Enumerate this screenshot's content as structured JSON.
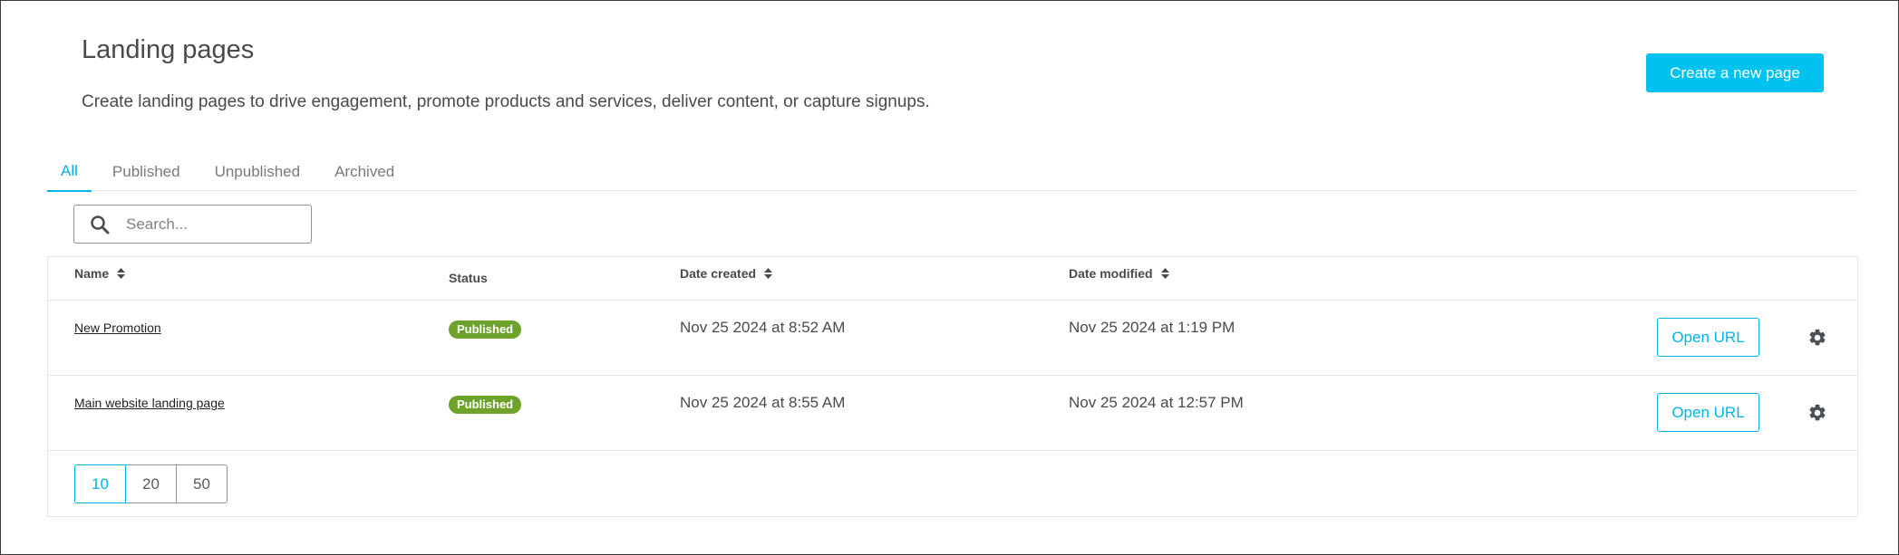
{
  "header": {
    "title": "Landing pages",
    "description": "Create landing pages to drive engagement, promote products and services, deliver content, or capture signups.",
    "create_button": "Create a new page"
  },
  "tabs": [
    {
      "label": "All",
      "active": true
    },
    {
      "label": "Published",
      "active": false
    },
    {
      "label": "Unpublished",
      "active": false
    },
    {
      "label": "Archived",
      "active": false
    }
  ],
  "search": {
    "placeholder": "Search...",
    "value": ""
  },
  "table": {
    "columns": {
      "name": "Name",
      "status": "Status",
      "date_created": "Date created",
      "date_modified": "Date modified"
    },
    "rows": [
      {
        "name": "New Promotion",
        "status": "Published",
        "date_created": "Nov 25 2024 at 8:52 AM",
        "date_modified": "Nov 25 2024 at 1:19 PM",
        "action": "Open URL"
      },
      {
        "name": "Main website landing page",
        "status": "Published",
        "date_created": "Nov 25 2024 at 8:55 AM",
        "date_modified": "Nov 25 2024 at 12:57 PM",
        "action": "Open URL"
      }
    ]
  },
  "pagination": {
    "sizes": [
      "10",
      "20",
      "50"
    ],
    "selected": "10"
  },
  "colors": {
    "accent": "#00b3e6",
    "primary_button": "#00c2f0",
    "published_badge": "#6ea32b"
  },
  "icons": {
    "search": "search-icon",
    "sort": "sort-icon",
    "settings": "gear-icon"
  }
}
